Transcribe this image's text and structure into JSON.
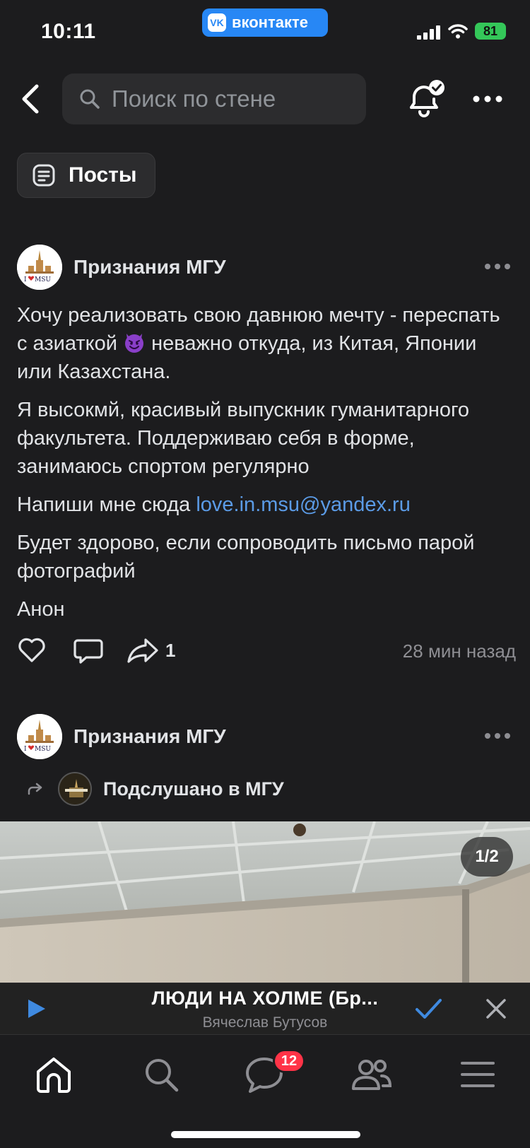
{
  "status_bar": {
    "time": "10:11",
    "app_pill_label": "вконтакте",
    "battery": "81"
  },
  "header": {
    "search_placeholder": "Поиск по стене"
  },
  "filter": {
    "posts_label": "Посты"
  },
  "posts": [
    {
      "author": "Признания МГУ",
      "paragraph1_before_emoji": "Хочу реализовать свою давнюю мечту - переспать с азиаткой ",
      "paragraph1_after_emoji": " неважно откуда, из Китая, Японии или Казахстана.",
      "paragraph2": "Я высокмй, красивый выпускник гуманитарного факультета. Поддерживаю себя в форме, занимаюсь спортом регулярно",
      "paragraph3_prefix": "Напиши мне сюда ",
      "paragraph3_link": "love.in.msu@yandex.ru",
      "paragraph4": "Будет здорово, если сопроводить письмо парой фотографий",
      "paragraph5": "Анон",
      "share_count": "1",
      "time_ago": "28 мин назад"
    },
    {
      "author": "Признания МГУ",
      "repost_source": "Подслушано в МГУ",
      "photo_counter": "1/2"
    }
  ],
  "avatar_logo_text": "I ♥ MSU",
  "player": {
    "track_title": "ЛЮДИ НА ХОЛМЕ (Бр...",
    "artist": "Вячеслав Бутусов"
  },
  "tabbar": {
    "messages_badge": "12"
  },
  "colors": {
    "accent": "#2787f5",
    "link": "#5b9be6",
    "badge": "#ff3347",
    "battery": "#34c759"
  }
}
